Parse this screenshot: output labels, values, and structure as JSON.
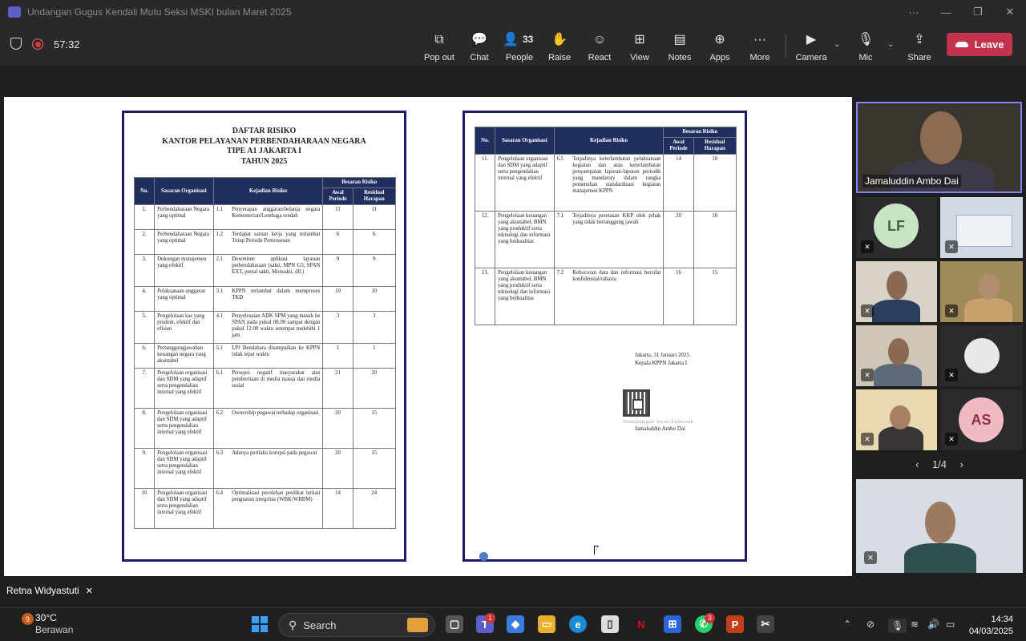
{
  "window": {
    "title": "Undangan Gugus Kendali Mutu Seksi MSKI bulan Maret 2025"
  },
  "meeting": {
    "timer": "57:32",
    "people_count": "33"
  },
  "toolbar": {
    "popout": "Pop out",
    "chat": "Chat",
    "people": "People",
    "raise": "Raise",
    "react": "React",
    "view": "View",
    "notes": "Notes",
    "apps": "Apps",
    "more": "More",
    "camera": "Camera",
    "mic": "Mic",
    "share": "Share",
    "leave": "Leave"
  },
  "doc": {
    "title_lines": [
      "DAFTAR RISIKO",
      "KANTOR PELAYANAN PERBENDAHARAAN NEGARA",
      "TIPE A1 JAKARTA I",
      "TAHUN 2025"
    ],
    "headers": {
      "no": "No.",
      "sasaran": "Sasaran Organisasi",
      "kejadian": "Kejadian Risiko",
      "besaran": "Besaran Risiko",
      "awal": "Awal Periode",
      "residual": "Residual Harapan"
    },
    "rows_page1": [
      {
        "no": "1.",
        "sasaran": "Perbendaharaan Negara yang optimal",
        "code": "1.1",
        "kejadian": "Penyerapan anggaran/belanja negara Kementerian/Lembaga rendah",
        "awal": "11",
        "residual": "11"
      },
      {
        "no": "2.",
        "sasaran": "Perbendaharaan Negara yang optimal",
        "code": "1.2",
        "kejadian": "Terdapat satuan kerja yang terlambat Tutup Periode Pemrosesan",
        "awal": "6",
        "residual": "6"
      },
      {
        "no": "3.",
        "sasaran": "Dukungan manajemen yang efektif",
        "code": "2.1",
        "kejadian": "Downtime aplikasi layanan perbendaharaan (sakti, MPN G3, SPAN EXT, portal sakti, Monsakti, dll.)",
        "awal": "9",
        "residual": "9"
      },
      {
        "no": "4.",
        "sasaran": "Pelaksanaan anggaran yang optimal",
        "code": "3.1",
        "kejadian": "KPPN terlambat dalam memproses TKD",
        "awal": "10",
        "residual": "10"
      },
      {
        "no": "5.",
        "sasaran": "Pengelolaan kas yang prudent, efektif dan efisien",
        "code": "4.1",
        "kejadian": "Penyelesaian ADK SPM yang masuk ke SPAN pada pukul 08.00 sampai dengan pukul 12.00 waktu setempat melebihi 1 jam",
        "awal": "3",
        "residual": "3"
      },
      {
        "no": "6.",
        "sasaran": "Pertanggungjawaban keuangan negara yang akuntabel",
        "code": "5.1",
        "kejadian": "LPJ Bendahara disampaikan ke KPPN tidak tepat waktu",
        "awal": "1",
        "residual": "1"
      },
      {
        "no": "7.",
        "sasaran": "Pengelolaan organisasi dan SDM yang adaptif serta pengendalian internal yang efektif",
        "code": "6.1",
        "kejadian": "Persepsi negatif masyarakat atas pemberitaan di media massa dan media sosial",
        "awal": "21",
        "residual": "20"
      },
      {
        "no": "8.",
        "sasaran": "Pengelolaan organisasi dan SDM yang adaptif serta pengendalian internal yang efektif",
        "code": "6.2",
        "kejadian": "Ownership pegawai terhadap organisasi",
        "awal": "20",
        "residual": "15"
      },
      {
        "no": "9.",
        "sasaran": "Pengelolaan organisasi dan SDM yang adaptif serta pengendalian internal yang efektif",
        "code": "6.3",
        "kejadian": "Adanya perilaku korupsi pada pegawai",
        "awal": "20",
        "residual": "15"
      },
      {
        "no": "10",
        "sasaran": "Pengelolaan organisasi dan SDM yang adaptif serta pengendalian internal yang efektif",
        "code": "6.4",
        "kejadian": "Optimalisasi perolehan predikat terkait penguatan integritas (WBK/WBBM)",
        "awal": "14",
        "residual": "24"
      }
    ],
    "rows_page2": [
      {
        "no": "11.",
        "sasaran": "Pengelolaan organisasi dan SDM yang adaptif serta pengendalian internal yang efektif",
        "code": "6.5",
        "kejadian": "Terjadinya keterlambatan pelaksanaan kegiatan dan atau keterlambatan penyampaian laporan-laporan periodik yang mandatory dalam rangka pemenuhan standardisasi kegiatan manajemen KPPN",
        "awal": "14",
        "residual": "10"
      },
      {
        "no": "12.",
        "sasaran": "Pengelolaan keuangan yang akuntabel, BMN yang produktif serta teknologi dan informasi yang berkualitas",
        "code": "7.1",
        "kejadian": "Terjadinya peretasan KKP oleh pihak yang tidak bertanggung jawab",
        "awal": "20",
        "residual": "10"
      },
      {
        "no": "13.",
        "sasaran": "Pengelolaan keuangan yang akuntabel, BMN yang produktif serta teknologi dan informasi yang berkualitas",
        "code": "7.2",
        "kejadian": "Kebocoran data dan informasi bersifat konfidensial/rahasia",
        "awal": "16",
        "residual": "15"
      }
    ],
    "signature": {
      "place_date": "Jakarta, 31 Januari 2025",
      "position": "Kepala KPPN Jakarta I",
      "esign": "Ditandatangani Secara Elektronik",
      "name": "Jamaluddin Ambo Dai"
    }
  },
  "participants": {
    "featured_name": "Jamaluddin Ambo Dai",
    "lf_initials": "LF",
    "as_initials": "AS",
    "pager": "1/4",
    "self_name": "Retna Widyastuti"
  },
  "taskbar": {
    "weather_badge": "9",
    "temperature": "30°C",
    "condition": "Berawan",
    "search": "Search",
    "teams_badge": "1",
    "whatsapp_badge": "3",
    "time": "14:34",
    "date": "04/03/2025"
  },
  "colors": {
    "leave": "#c4314b",
    "table_header": "#1f2f5f",
    "page_border": "#1b1b6d",
    "accent": "#5b5fc7"
  }
}
